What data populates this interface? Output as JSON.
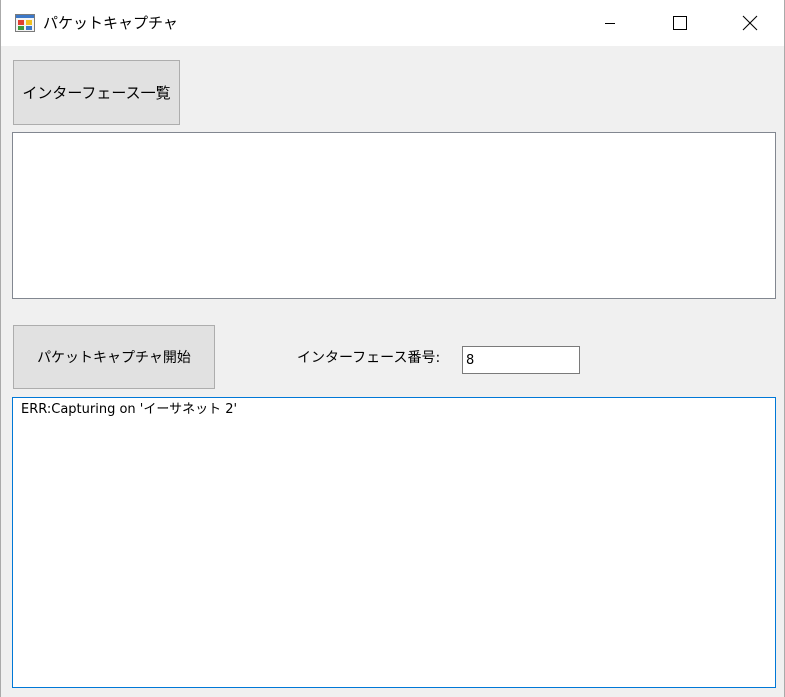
{
  "window": {
    "title": "パケットキャプチャ",
    "icon": "form-icon",
    "controls": {
      "minimize": "minimize-icon",
      "maximize": "maximize-icon",
      "close": "close-icon"
    }
  },
  "main": {
    "list_interfaces_label": "インターフェース一覧",
    "interfaces_list": [],
    "start_capture_label": "パケットキャプチャ開始",
    "interface_number_label": "インターフェース番号:",
    "interface_number_value": "8",
    "output_text": "ERR:Capturing on 'イーサネット 2'"
  },
  "colors": {
    "window_bg": "#f0f0f0",
    "titlebar_bg": "#ffffff",
    "button_bg": "#e1e1e1",
    "focus_border": "#0078d7"
  }
}
